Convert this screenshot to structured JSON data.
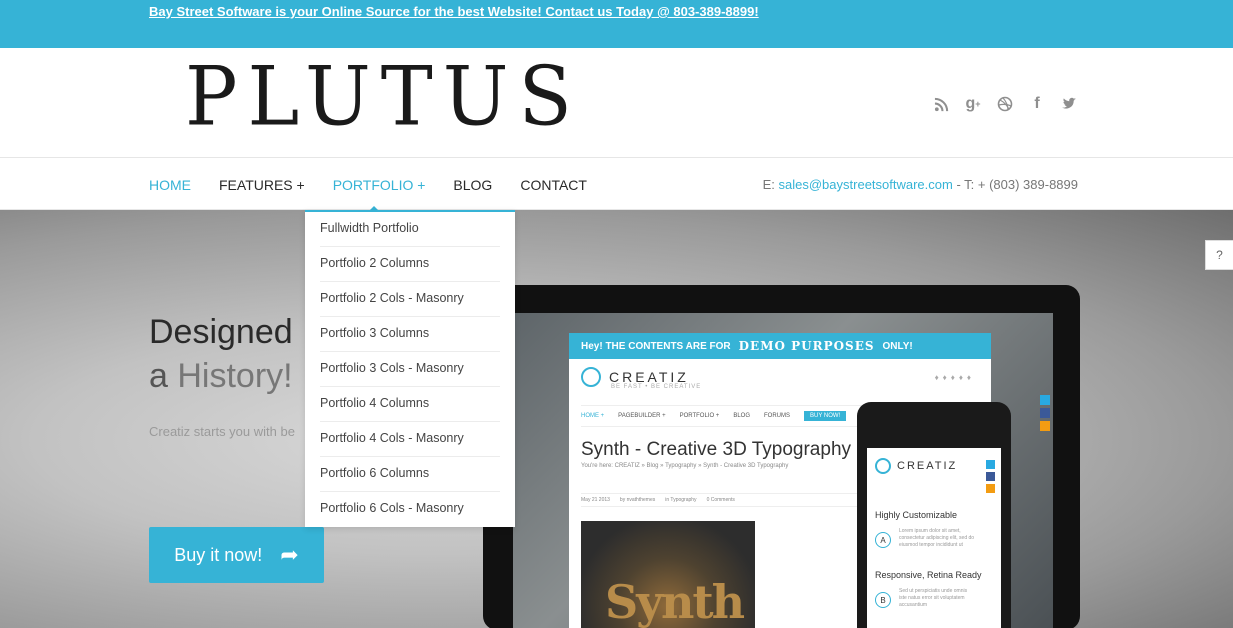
{
  "topbar": {
    "announcement": "Bay Street Software is your Online Source for the best Website! Contact us Today @ 803-389-8899!",
    "color": "#36b3d6"
  },
  "header": {
    "logo_text": "PLUTUS",
    "social_icons": [
      "rss-icon",
      "google-plus-icon",
      "dribbble-icon",
      "facebook-icon",
      "twitter-icon"
    ]
  },
  "nav": {
    "items": [
      {
        "label": "HOME"
      },
      {
        "label": "FEATURES +"
      },
      {
        "label": "PORTFOLIO +"
      },
      {
        "label": "BLOG"
      },
      {
        "label": "CONTACT"
      }
    ],
    "contact_prefix": "E: ",
    "email": "sales@baystreetsoftware.com",
    "phone": " - T: + (803) 389-8899"
  },
  "dropdown": {
    "items": [
      "Fullwidth Portfolio",
      "Portfolio 2 Columns",
      "Portfolio 2 Cols - Masonry",
      "Portfolio 3 Columns",
      "Portfolio 3 Cols - Masonry",
      "Portfolio 4 Columns",
      "Portfolio 4 Cols - Masonry",
      "Portfolio 6 Columns",
      "Portfolio 6 Cols - Masonry"
    ]
  },
  "hero": {
    "line1": "Designed",
    "line2_prefix": "a ",
    "line2_highlight": "History!",
    "subtext": "Creatiz starts you with be",
    "buy_label": "Buy it now!"
  },
  "mockup": {
    "strip_intro": "Hey!  THE CONTENTS ARE FOR",
    "strip_big": "DEMO PURPOSES",
    "strip_end": "ONLY!",
    "brand": "CREATIZ",
    "brand_tag": "BE FAST • BE CREATIVE",
    "nav": [
      "HOME +",
      "PAGEBUILDER +",
      "PORTFOLIO +",
      "BLOG",
      "FORUMS",
      "BUY NOW!"
    ],
    "post_title": "Synth - Creative 3D Typography",
    "crumb": "You're here: CREATIZ » Blog » Typography » Synth - Creative 3D Typography",
    "meta_date": "May 21 2013",
    "meta_by": "by nvaththemes",
    "meta_in": "in Typography",
    "meta_comments": "0 Comments",
    "image_word": "Synth",
    "phone_brand": "CREATIZ",
    "phone_h1": "Highly Customizable",
    "phone_c1": "A",
    "phone_t1": "Lorem ipsum dolor sit amet, consectetur adipiscing elit, sed do eiusmod tempor incididunt ut",
    "phone_h2": "Responsive, Retina Ready",
    "phone_c2": "B",
    "phone_t2": "Sed ut perspiciatis unde omnis iste natus error sit voluptatem accusantium"
  },
  "help_label": "?"
}
